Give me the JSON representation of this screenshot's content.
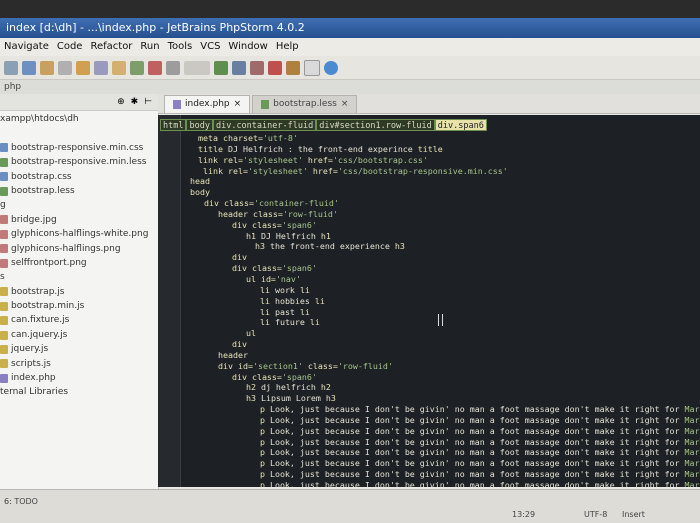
{
  "window": {
    "title": "index [d:\\dh] - ...\\index.php - JetBrains PhpStorm 4.0.2"
  },
  "menu": [
    "Navigate",
    "Code",
    "Refactor",
    "Run",
    "Tools",
    "VCS",
    "Window",
    "Help"
  ],
  "navbar": {
    "text": "php"
  },
  "project_panel": {
    "header_icons": [
      "settings-icon",
      "gear-icon",
      "hide-icon"
    ],
    "items": [
      "xampp\\htdocs\\dh",
      "",
      "bootstrap-responsive.min.css",
      "bootstrap-responsive.min.less",
      "bootstrap.css",
      "bootstrap.less",
      "g",
      "bridge.jpg",
      "glyphicons-halflings-white.png",
      "glyphicons-halflings.png",
      "selffrontport.png",
      "s",
      "bootstrap.js",
      "bootstrap.min.js",
      "can.fixture.js",
      "can.jquery.js",
      "jquery.js",
      "scripts.js",
      "index.php",
      "ternal Libraries"
    ]
  },
  "tabs": [
    {
      "label": "index.php",
      "active": true
    },
    {
      "label": "bootstrap.less",
      "active": false
    }
  ],
  "breadcrumbs": [
    "html",
    "body",
    "div.container-fluid",
    "div#section1.row-fluid",
    "div.span6"
  ],
  "code_lines": [
    [
      {
        "c": "t",
        "v": "meta charset="
      },
      {
        "c": "s",
        "v": "'utf-8'"
      }
    ],
    [
      {
        "c": "t",
        "v": "title"
      },
      {
        "c": "p",
        "v": " DJ Helfrich : the front-end experince "
      },
      {
        "c": "t",
        "v": "title"
      }
    ],
    [
      {
        "c": "t",
        "v": "link rel="
      },
      {
        "c": "s",
        "v": "'stylesheet'"
      },
      {
        "c": "t",
        "v": " href="
      },
      {
        "c": "s",
        "v": "'css/bootstrap.css'"
      }
    ],
    [
      {
        "c": "t",
        "v": " link rel="
      },
      {
        "c": "s",
        "v": "'stylesheet'"
      },
      {
        "c": "t",
        "v": " href="
      },
      {
        "c": "s",
        "v": "'css/bootstrap-responsive.min.css'"
      }
    ],
    [
      {
        "c": "t",
        "v": "head"
      }
    ],
    [
      {
        "c": "t",
        "v": "body"
      }
    ],
    [
      {
        "c": "t",
        "v": "  div class="
      },
      {
        "c": "s",
        "v": "'container-fluid'"
      }
    ],
    [
      {
        "c": "t",
        "v": "    header class="
      },
      {
        "c": "s",
        "v": "'row-fluid'"
      }
    ],
    [
      {
        "c": "t",
        "v": "      div class="
      },
      {
        "c": "s",
        "v": "'span6'"
      }
    ],
    [
      {
        "c": "t",
        "v": "        h1"
      },
      {
        "c": "p",
        "v": " DJ Helfrich "
      },
      {
        "c": "t",
        "v": "h1"
      }
    ],
    [
      {
        "c": "t",
        "v": "         h3"
      },
      {
        "c": "p",
        "v": " the front-end experience "
      },
      {
        "c": "t",
        "v": "h3"
      }
    ],
    [
      {
        "c": "t",
        "v": "      div"
      }
    ],
    [
      {
        "c": "t",
        "v": "      div class="
      },
      {
        "c": "s",
        "v": "'span6'"
      }
    ],
    [
      {
        "c": "t",
        "v": "        ul id="
      },
      {
        "c": "s",
        "v": "'nav'"
      }
    ],
    [
      {
        "c": "t",
        "v": "          li"
      },
      {
        "c": "p",
        "v": " work "
      },
      {
        "c": "t",
        "v": "li"
      }
    ],
    [
      {
        "c": "t",
        "v": "          li"
      },
      {
        "c": "p",
        "v": " hobbies "
      },
      {
        "c": "t",
        "v": "li"
      }
    ],
    [
      {
        "c": "t",
        "v": "          li"
      },
      {
        "c": "p",
        "v": " past "
      },
      {
        "c": "t",
        "v": "li"
      }
    ],
    [
      {
        "c": "t",
        "v": "          li"
      },
      {
        "c": "p",
        "v": " future "
      },
      {
        "c": "t",
        "v": "li"
      }
    ],
    [
      {
        "c": "t",
        "v": "        ul"
      }
    ],
    [
      {
        "c": "t",
        "v": "      div"
      }
    ],
    [
      {
        "c": "t",
        "v": "    header"
      }
    ],
    [
      {
        "c": "t",
        "v": "    div id="
      },
      {
        "c": "s",
        "v": "'section1'"
      },
      {
        "c": "t",
        "v": " class="
      },
      {
        "c": "s",
        "v": "'row-fluid'"
      }
    ],
    [
      {
        "c": "t",
        "v": "      div class="
      },
      {
        "c": "s",
        "v": "'span6'"
      }
    ],
    [
      {
        "c": "t",
        "v": "        h2"
      },
      {
        "c": "p",
        "v": " dj helfrich "
      },
      {
        "c": "t",
        "v": "h2"
      }
    ],
    [
      {
        "c": "t",
        "v": "        h3"
      },
      {
        "c": "p",
        "v": " Lipsum Lorem "
      },
      {
        "c": "t",
        "v": "h3"
      }
    ],
    [
      {
        "c": "t",
        "v": "          p"
      },
      {
        "c": "p",
        "v": " Look, just because I don't be givin' no man a foot massage don't make it right for "
      },
      {
        "c": "s",
        "v": "Marsellus to thr"
      }
    ],
    [
      {
        "c": "t",
        "v": "          p"
      },
      {
        "c": "p",
        "v": " Look, just because I don't be givin' no man a foot massage don't make it right for "
      },
      {
        "c": "s",
        "v": "Marsellus to thr"
      }
    ],
    [
      {
        "c": "t",
        "v": "          p"
      },
      {
        "c": "p",
        "v": " Look, just because I don't be givin' no man a foot massage don't make it right for "
      },
      {
        "c": "s",
        "v": "Marsellus to thr"
      }
    ],
    [
      {
        "c": "t",
        "v": "          p"
      },
      {
        "c": "p",
        "v": " Look, just because I don't be givin' no man a foot massage don't make it right for "
      },
      {
        "c": "s",
        "v": "Marsellus to thr"
      }
    ],
    [
      {
        "c": "t",
        "v": "          p"
      },
      {
        "c": "p",
        "v": " Look, just because I don't be givin' no man a foot massage don't make it right for "
      },
      {
        "c": "s",
        "v": "Marsellus to thr"
      }
    ],
    [
      {
        "c": "t",
        "v": "          p"
      },
      {
        "c": "p",
        "v": " Look, just because I don't be givin' no man a foot massage don't make it right for "
      },
      {
        "c": "s",
        "v": "Marsellus to thr"
      }
    ],
    [
      {
        "c": "t",
        "v": "          p"
      },
      {
        "c": "p",
        "v": " Look, just because I don't be givin' no man a foot massage don't make it right for "
      },
      {
        "c": "s",
        "v": "Marsellus to thr"
      }
    ],
    [
      {
        "c": "t",
        "v": "          p"
      },
      {
        "c": "p",
        "v": " Look, just because I don't be givin' no man a foot massage don't make it right for "
      },
      {
        "c": "s",
        "v": "Marsellus to thr"
      }
    ]
  ],
  "status": {
    "todo": "6: TODO",
    "position": "13:29",
    "encoding": "UTF-8",
    "mode": "Insert"
  },
  "colors": {
    "editor_bg": "#1d2024",
    "tag": "#e8e4b8",
    "string": "#a6c58c",
    "breadcrumb_border": "#6c8f53"
  }
}
